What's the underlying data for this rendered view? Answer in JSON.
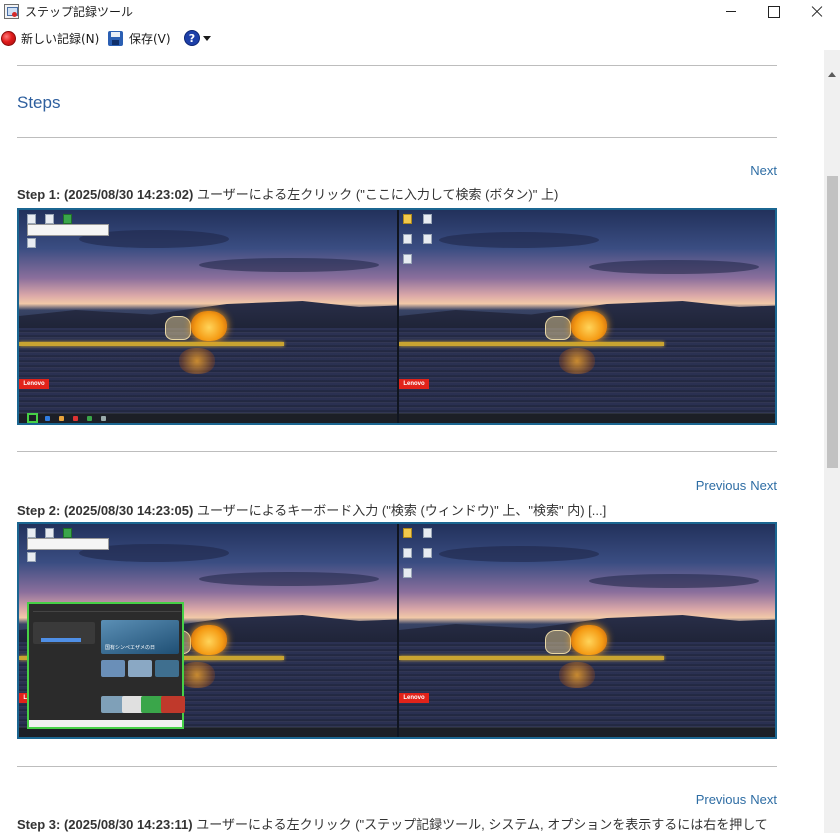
{
  "window": {
    "title": "ステップ記録ツール"
  },
  "toolbar": {
    "new_recording": "新しい記録(N)",
    "save": "保存(V)",
    "help_glyph": "?"
  },
  "document": {
    "heading": "Steps",
    "nav": {
      "previous": "Previous",
      "next": "Next"
    },
    "steps": [
      {
        "label": "Step 1: (2025/08/30 14:23:02)",
        "description": "ユーザーによる左クリック (\"ここに入力して検索 (ボタン)\" 上)"
      },
      {
        "label": "Step 2: (2025/08/30 14:23:05)",
        "description": "ユーザーによるキーボード入力 (\"検索 (ウィンドウ)\" 上、\"検索\" 内) [...]"
      },
      {
        "label": "Step 3: (2025/08/30 14:23:11)",
        "description": "ユーザーによる左クリック (\"ステップ記録ツール, システム, オプションを表示するには右を押して"
      }
    ],
    "screenshot_badge": "Lenovo",
    "search_panel_headline": "国有シンペエザメの日"
  },
  "colors": {
    "accent_link": "#2e6da4",
    "heading": "#2e5f9e",
    "screenshot_border": "#1b6691",
    "highlight": "#46d046",
    "record_red": "#e01b1b"
  },
  "icons": {
    "record": "record-icon",
    "save": "save-disk-icon",
    "help": "help-icon",
    "close": "close-icon",
    "minimize": "minimize-icon",
    "maximize": "maximize-icon"
  }
}
